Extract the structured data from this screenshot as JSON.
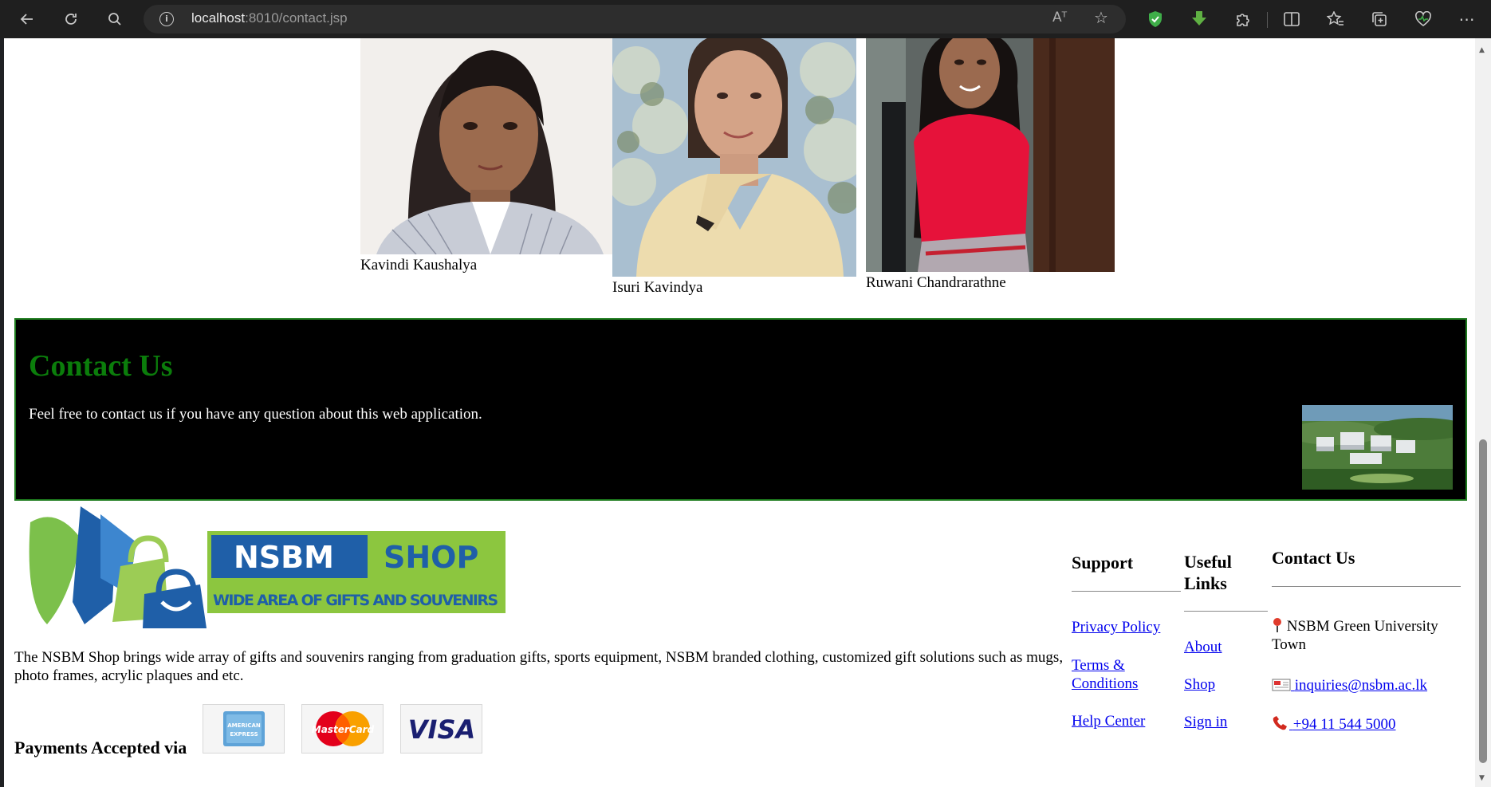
{
  "browser": {
    "url_host": "localhost",
    "url_path": ":8010/contact.jsp",
    "readaloud_label": "Aᵀ",
    "favorite_icon": "star-icon"
  },
  "team": {
    "members": [
      {
        "name": "Kavindi Kaushalya"
      },
      {
        "name": "Isuri Kavindya"
      },
      {
        "name": "Ruwani Chandrarathne"
      }
    ]
  },
  "contact_banner": {
    "title": "Contact Us",
    "text": "Feel free to contact us if you have any question about this web application."
  },
  "footer": {
    "logo": {
      "brand_left": "NSBM",
      "brand_right": "SHOP",
      "tagline": "WIDE AREA OF GIFTS AND SOUVENIRS"
    },
    "about_text": "The NSBM Shop brings wide array of gifts and souvenirs ranging from graduation gifts, sports equipment, NSBM branded clothing, customized gift solutions such as mugs, photo frames, acrylic plaques and etc.",
    "payments_label": "Payments Accepted via",
    "cards": [
      {
        "label": "AMERICAN EXPRESS",
        "icon": "amex-card-icon"
      },
      {
        "label": "MasterCard",
        "icon": "mastercard-icon"
      },
      {
        "label": "VISA",
        "icon": "visa-card-icon"
      }
    ],
    "support": {
      "title": "Support",
      "links": [
        "Privacy Policy",
        "Terms & Conditions",
        "Help Center"
      ]
    },
    "useful_links": {
      "title": "Useful Links",
      "links": [
        "About",
        "Shop",
        "Sign in"
      ]
    },
    "contact": {
      "title": "Contact Us",
      "address": "NSBM Green University Town",
      "email": "inquiries@nsbm.ac.lk",
      "phone": "+94 11 544 5000"
    }
  },
  "colors": {
    "contact_title": "#0b7d0b",
    "link": "#0000ee",
    "banner_bg": "#000000",
    "banner_border": "#1d7a1d",
    "logo_blue": "#1f5fa8",
    "logo_green": "#8cc63f"
  }
}
